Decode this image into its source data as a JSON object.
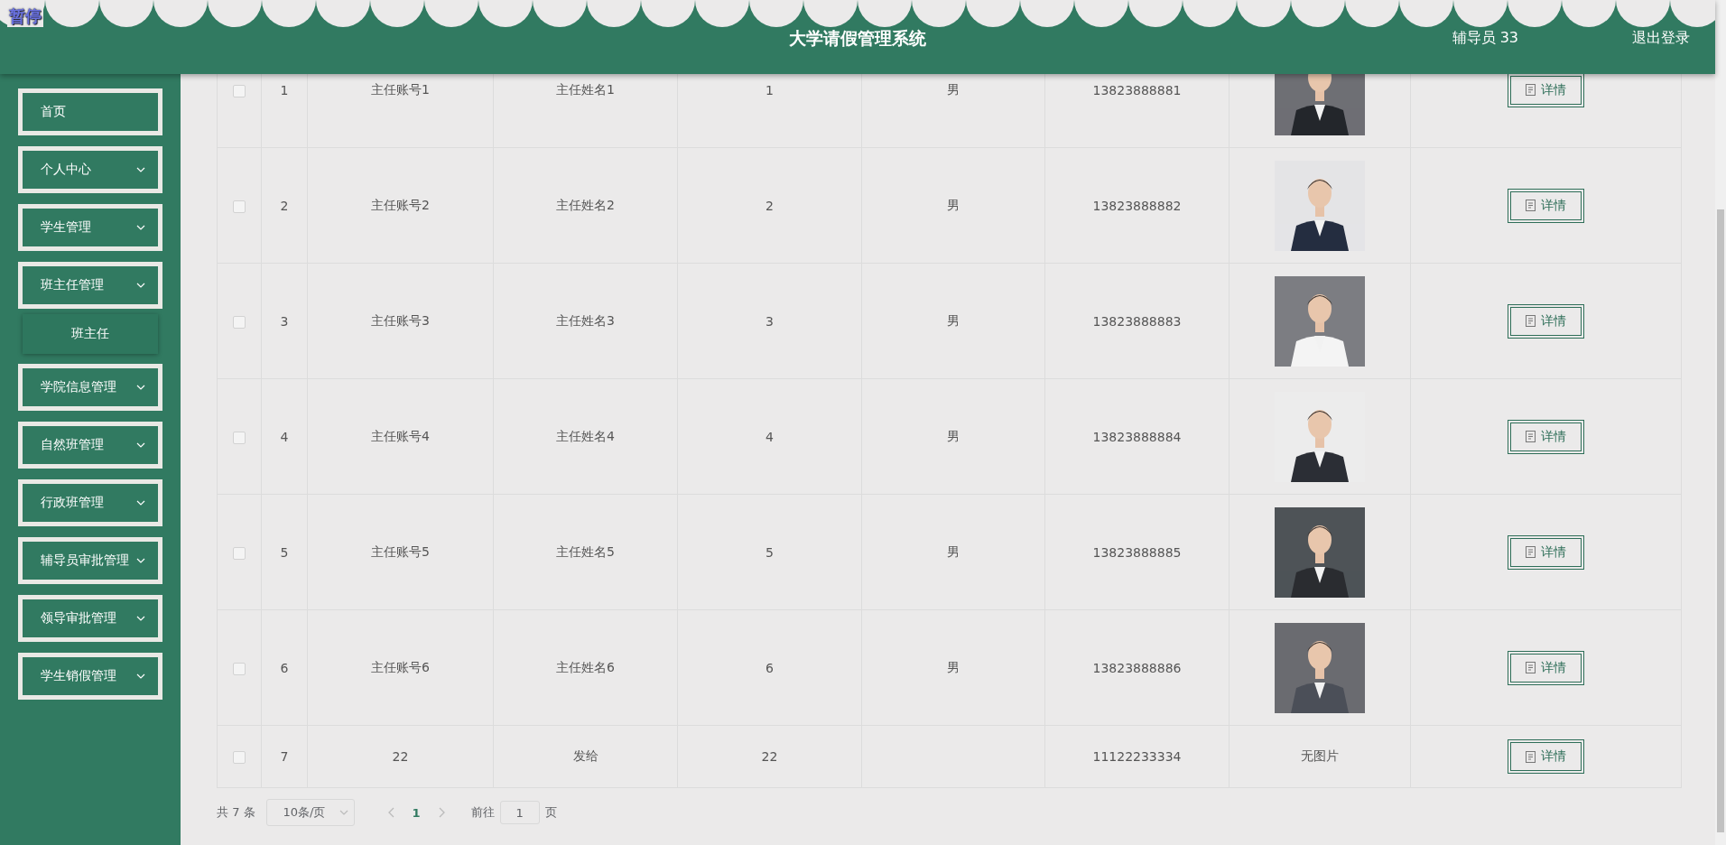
{
  "overlay_label": "暂停",
  "header": {
    "title": "大学请假管理系统",
    "user": "辅导员 33",
    "logout": "退出登录"
  },
  "sidebar": {
    "items": [
      {
        "label": "首页",
        "kind": "link"
      },
      {
        "label": "个人中心",
        "kind": "submenu"
      },
      {
        "label": "学生管理",
        "kind": "submenu"
      },
      {
        "label": "班主任管理",
        "kind": "submenu",
        "children": [
          {
            "label": "班主任",
            "selected": true
          }
        ]
      },
      {
        "label": "学院信息管理",
        "kind": "submenu"
      },
      {
        "label": "自然班管理",
        "kind": "submenu"
      },
      {
        "label": "行政班管理",
        "kind": "submenu"
      },
      {
        "label": "辅导员审批管理",
        "kind": "submenu"
      },
      {
        "label": "领导审批管理",
        "kind": "submenu"
      },
      {
        "label": "学生销假管理",
        "kind": "submenu"
      }
    ]
  },
  "table": {
    "rows": [
      {
        "checked": false,
        "index": "1",
        "cells": [
          "主任账号1",
          "主任姓名1",
          "1",
          "男",
          "13823888881"
        ],
        "action": "详情"
      },
      {
        "checked": false,
        "index": "2",
        "cells": [
          "主任账号2",
          "主任姓名2",
          "2",
          "男",
          "13823888882"
        ],
        "action": "详情"
      },
      {
        "checked": false,
        "index": "3",
        "cells": [
          "主任账号3",
          "主任姓名3",
          "3",
          "男",
          "13823888883"
        ],
        "action": "详情"
      },
      {
        "checked": false,
        "index": "4",
        "cells": [
          "主任账号4",
          "主任姓名4",
          "4",
          "男",
          "13823888884"
        ],
        "action": "详情"
      },
      {
        "checked": false,
        "index": "5",
        "cells": [
          "主任账号5",
          "主任姓名5",
          "5",
          "男",
          "13823888885"
        ],
        "action": "详情"
      },
      {
        "checked": false,
        "index": "6",
        "cells": [
          "主任账号6",
          "主任姓名6",
          "6",
          "男",
          "13823888886"
        ],
        "action": "详情"
      },
      {
        "checked": false,
        "index": "7",
        "cells": [
          "22",
          "发给",
          "22",
          "",
          "11122233334"
        ],
        "photo": {
          "kind": "text",
          "text": "无图片"
        },
        "action": "详情"
      }
    ]
  },
  "pagination": {
    "total": "共 7 条",
    "page_size": "10条/页",
    "pages": [
      {
        "label": "1",
        "selected": true
      }
    ],
    "goto_label": "前往",
    "goto_value": "1",
    "goto_suffix": "页"
  }
}
